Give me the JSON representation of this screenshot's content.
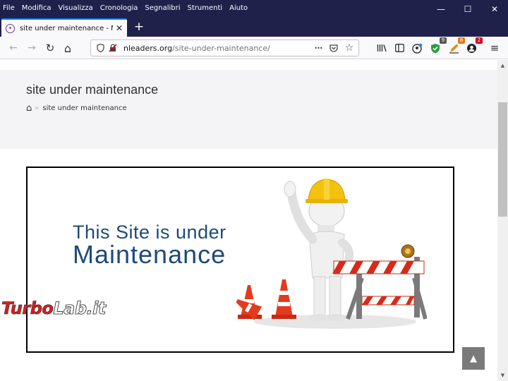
{
  "browser": {
    "menu": [
      "File",
      "Modifica",
      "Visualizza",
      "Cronologia",
      "Segnalibri",
      "Strumenti",
      "Aiuto"
    ],
    "window_controls": {
      "minimize": "—",
      "maximize": "☐",
      "close": "✕"
    },
    "tab": {
      "title": "site under maintenance - NLeaders",
      "close": "✕"
    },
    "new_tab": "+",
    "nav": {
      "back": "←",
      "forward": "→",
      "reload": "↻",
      "home": "⌂"
    },
    "url": {
      "host": "nleaders.org",
      "path": "/site-under-maintenance/"
    },
    "url_actions": {
      "more": "•••",
      "pocket": "⛉",
      "bookmark": "☆"
    },
    "extension_badges": [
      "9",
      "8",
      "2"
    ],
    "menu_button": "≡",
    "accent_color": "#0a84ff"
  },
  "page": {
    "title": "site under maintenance",
    "breadcrumb": {
      "home_icon": "⌂",
      "separator": "»",
      "current": "site under maintenance"
    },
    "banner": {
      "line1": "This Site is under",
      "line2": "Maintenance"
    },
    "to_top": "▲"
  },
  "watermark": {
    "part1": "Turbo",
    "part2": "Lab.it"
  }
}
